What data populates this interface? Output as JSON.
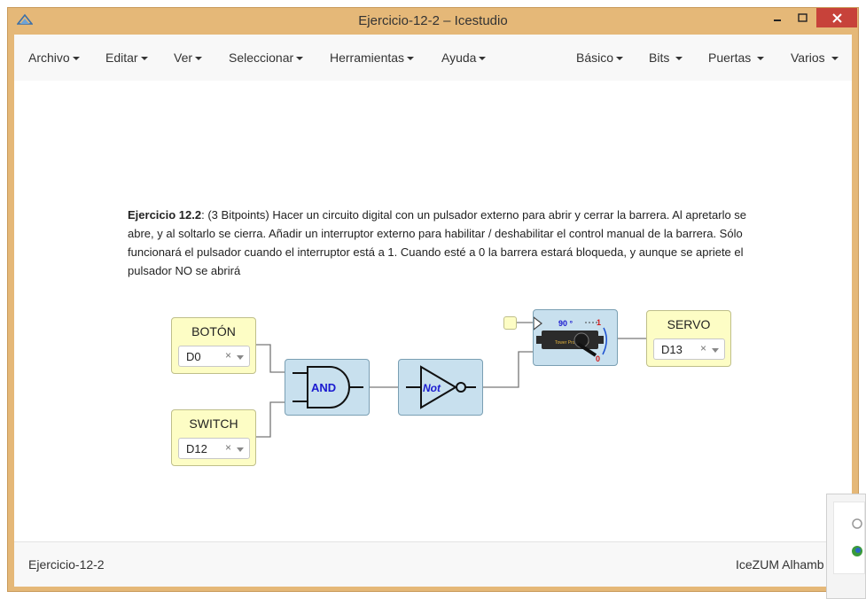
{
  "window": {
    "title": "Ejercicio-12-2 – Icestudio"
  },
  "menus_left": [
    {
      "label": "Archivo"
    },
    {
      "label": "Editar"
    },
    {
      "label": "Ver"
    },
    {
      "label": "Seleccionar"
    },
    {
      "label": "Herramientas"
    },
    {
      "label": "Ayuda"
    }
  ],
  "menus_right": [
    {
      "label": "Básico"
    },
    {
      "label": "Bits"
    },
    {
      "label": "Puertas"
    },
    {
      "label": "Varios"
    }
  ],
  "description": {
    "bold": "Ejercicio 12.2",
    "rest": ": (3 Bitpoints) Hacer un circuito digital con un pulsador externo para abrir y cerrar la barrera. Al apretarlo se abre, y al soltarlo se cierra. Añadir un interruptor externo para habilitar / deshabilitar el control manual de la barrera. Sólo funcionará el pulsador cuando el interruptor está a 1. Cuando esté a 0 la barrera estará bloqueda, y aunque se apriete el pulsador NO se abrirá"
  },
  "blocks": {
    "boton": {
      "label": "BOTÓN",
      "pin": "D0"
    },
    "switch": {
      "label": "SWITCH",
      "pin": "D12"
    },
    "and": {
      "label": "AND"
    },
    "not": {
      "label": "Not"
    },
    "servo_icon": {
      "angle": "90 °",
      "one": "1",
      "zero": "0",
      "brand": "Tower Pro SG-90"
    },
    "servo": {
      "label": "SERVO",
      "pin": "D13"
    }
  },
  "clear_symbol": "×",
  "footer": {
    "left": "Ejercicio-12-2",
    "right": "IceZUM Alhamb"
  },
  "colors": {
    "frame": "#e5b878",
    "close": "#c7423a",
    "logic_block": "#c8e0ee",
    "io_block": "#fdfdc5"
  }
}
